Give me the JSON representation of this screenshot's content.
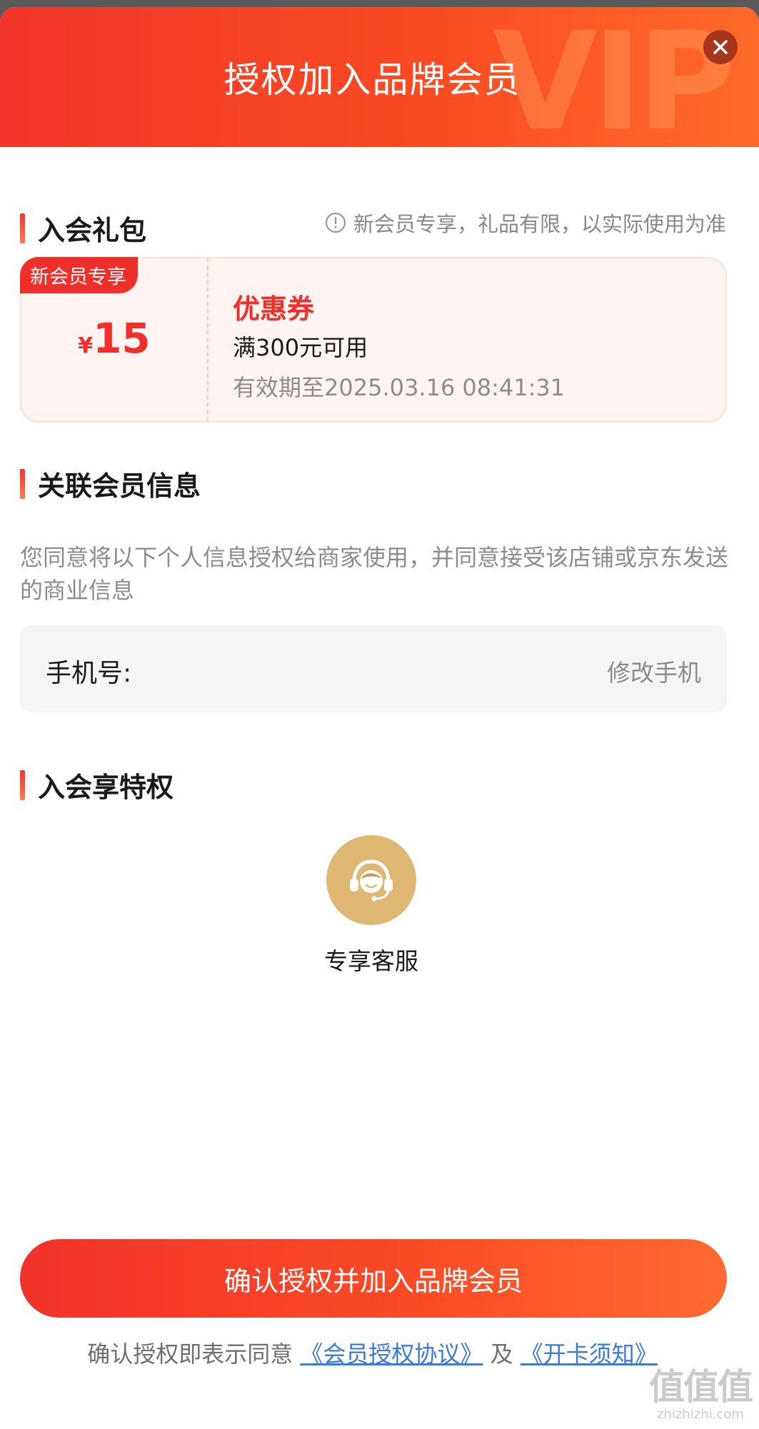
{
  "header": {
    "title": "授权加入品牌会员",
    "watermark": "VIP",
    "close_icon": "close-icon"
  },
  "gift_section": {
    "title": "入会礼包",
    "note": "新会员专享，礼品有限，以实际使用为准",
    "note_icon": "info-icon",
    "coupon": {
      "badge": "新会员专享",
      "currency": "¥",
      "amount": "15",
      "title": "优惠券",
      "condition": "满300元可用",
      "expiry": "有效期至2025.03.16 08:41:31"
    }
  },
  "member_info_section": {
    "title": "关联会员信息",
    "consent": "您同意将以下个人信息授权给商家使用，并同意接受该店铺或京东发送的商业信息",
    "phone": {
      "label": "手机号:",
      "value": "",
      "modify_label": "修改手机"
    }
  },
  "privilege_section": {
    "title": "入会享特权",
    "items": [
      {
        "label": "专享客服",
        "icon": "customer-service-icon"
      }
    ]
  },
  "confirm_button": "确认授权并加入品牌会员",
  "footer": {
    "prefix": "确认授权即表示同意",
    "link1": "《会员授权协议》",
    "connector": "及",
    "link2": "《开卡须知》"
  },
  "watermark": {
    "logo": "值值值",
    "site": "zhizhizhi.com"
  },
  "colors": {
    "accent": "#ee2f2a",
    "gold": "#deb873",
    "link": "#3a7bd5"
  }
}
